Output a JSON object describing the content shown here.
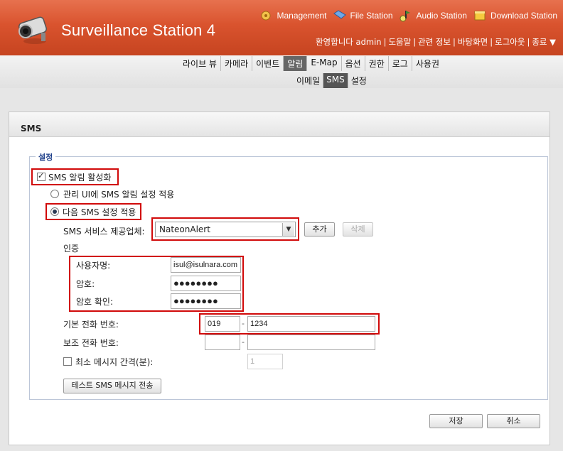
{
  "app": {
    "title": "Surveillance Station 4"
  },
  "top_links": [
    {
      "label": "Management",
      "icon": "management-icon"
    },
    {
      "label": "File Station",
      "icon": "file-station-icon"
    },
    {
      "label": "Audio Station",
      "icon": "audio-station-icon"
    },
    {
      "label": "Download Station",
      "icon": "download-station-icon"
    }
  ],
  "user_bar": {
    "welcome": "환영합니다 admin",
    "help": "도움말",
    "related": "관련 정보",
    "desktop": "바탕화면",
    "logout": "로그아웃",
    "exit": "종료 ▼"
  },
  "main_tabs": [
    "라이브 뷰",
    "카메라",
    "이벤트",
    "알림",
    "E-Map",
    "옵션",
    "권한",
    "로그",
    "사용권"
  ],
  "main_tab_active": "알림",
  "sub_tabs": [
    "이메일",
    "SMS",
    "설정"
  ],
  "sub_tab_active": "SMS",
  "panel": {
    "title": "SMS"
  },
  "settings": {
    "legend": "설정",
    "enable_sms": {
      "label": "SMS 알림 활성화",
      "checked": true
    },
    "radio_ui": {
      "label": "관리 UI에 SMS 알림 설정 적용",
      "selected": false
    },
    "radio_custom": {
      "label": "다음 SMS 설정 적용",
      "selected": true
    },
    "provider": {
      "label": "SMS 서비스 제공업체:",
      "value": "NateonAlert",
      "add": "추가",
      "delete": "삭제"
    },
    "auth": {
      "heading": "인증",
      "username_label": "사용자명:",
      "username_value": "isul@isulnara.com",
      "password_label": "암호:",
      "password_value": "●●●●●●●●",
      "confirm_label": "암호 확인:",
      "confirm_value": "●●●●●●●●"
    },
    "primary_phone": {
      "label": "기본 전화 번호:",
      "prefix": "019",
      "number": "1234"
    },
    "secondary_phone": {
      "label": "보조 전화 번호:",
      "prefix": "",
      "number": ""
    },
    "min_interval": {
      "label": "최소 메시지 간격(분):",
      "checked": false,
      "value": "1"
    },
    "test_button": "테스트 SMS 메시지 전송"
  },
  "footer": {
    "save": "저장",
    "cancel": "취소"
  },
  "colors": {
    "header": "#d9532e",
    "highlight": "#d10a0a",
    "legend": "#1e3f8a"
  }
}
